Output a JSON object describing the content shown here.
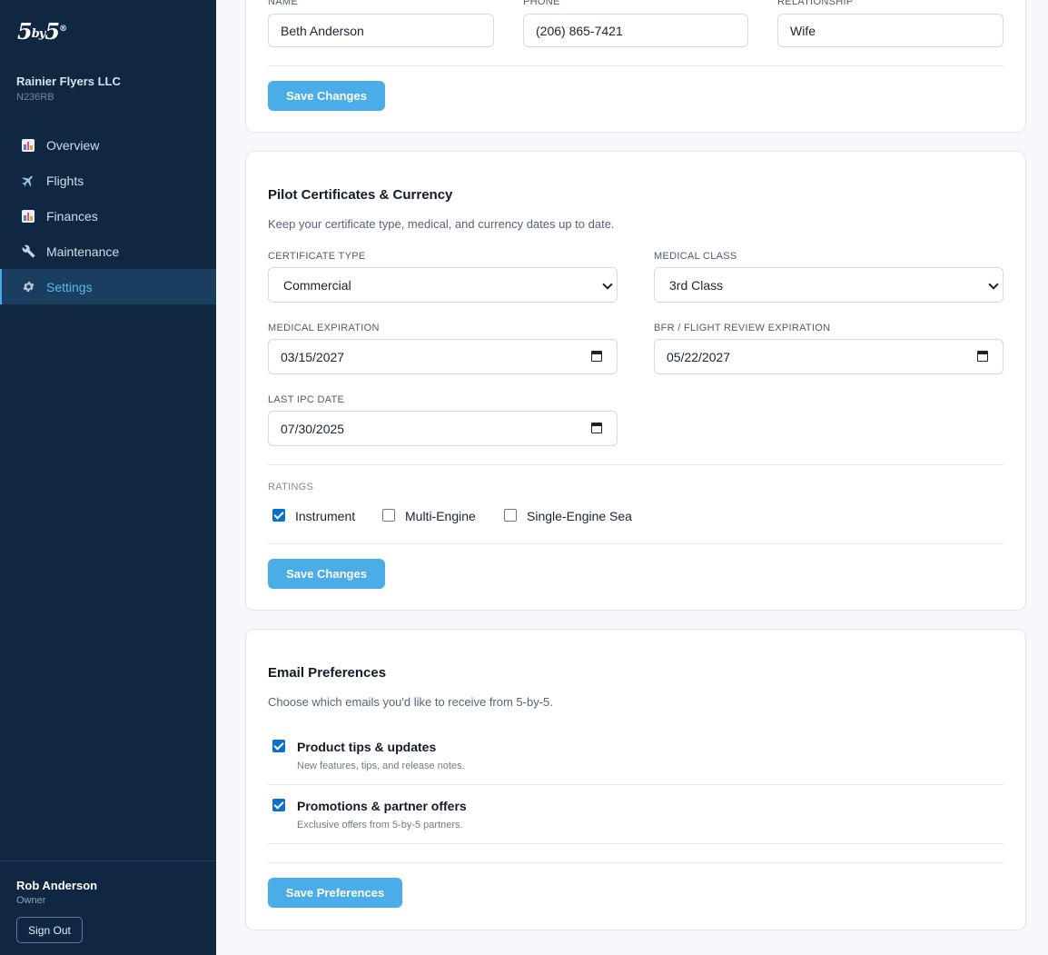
{
  "sidebar": {
    "logo": {
      "main": "5",
      "mid": "by",
      "end": "5",
      "mark": "®"
    },
    "org": {
      "name": "Rainier Flyers LLC",
      "tail": "N236RB"
    },
    "nav": [
      {
        "label": "Overview",
        "icon": "bar-chart-icon",
        "active": false
      },
      {
        "label": "Flights",
        "icon": "airplane-icon",
        "active": false
      },
      {
        "label": "Finances",
        "icon": "bar-chart-icon",
        "active": false
      },
      {
        "label": "Maintenance",
        "icon": "wrench-icon",
        "active": false
      },
      {
        "label": "Settings",
        "icon": "gear-icon",
        "active": true
      }
    ],
    "user": {
      "name": "Rob Anderson",
      "role": "Owner",
      "signout_label": "Sign Out"
    }
  },
  "emergency": {
    "name_label": "Name",
    "name_value": "Beth Anderson",
    "phone_label": "Phone",
    "phone_value": "(206) 865-7421",
    "relationship_label": "Relationship",
    "relationship_value": "Wife",
    "save_label": "Save Changes"
  },
  "pilot": {
    "title": "Pilot Certificates & Currency",
    "description": "Keep your certificate type, medical, and currency dates up to date.",
    "certificate_label": "Certificate Type",
    "certificate_value": "Commercial",
    "medical_class_label": "Medical Class",
    "medical_class_value": "3rd Class",
    "medical_exp_label": "Medical Expiration",
    "medical_exp_value": "03/15/2027",
    "bfr_label": "BFR / Flight Review Expiration",
    "bfr_value": "05/22/2027",
    "ipc_label": "Last IPC Date",
    "ipc_value": "07/30/2025",
    "ratings_label": "Ratings",
    "ratings": [
      {
        "label": "Instrument",
        "checked": true
      },
      {
        "label": "Multi-Engine",
        "checked": false
      },
      {
        "label": "Single-Engine Sea",
        "checked": false
      }
    ],
    "save_label": "Save Changes"
  },
  "email": {
    "title": "Email Preferences",
    "description": "Choose which emails you'd like to receive from 5-by-5.",
    "prefs": [
      {
        "title": "Product tips & updates",
        "subtitle": "New features, tips, and release notes.",
        "checked": true
      },
      {
        "title": "Promotions & partner offers",
        "subtitle": "Exclusive offers from 5-by-5 partners.",
        "checked": true
      }
    ],
    "save_label": "Save Preferences"
  },
  "colors": {
    "sidebar_bg": "#0f2740",
    "accent": "#4aace8",
    "active_nav": "#5bb8ee",
    "checkbox": "#0b6fcc"
  }
}
